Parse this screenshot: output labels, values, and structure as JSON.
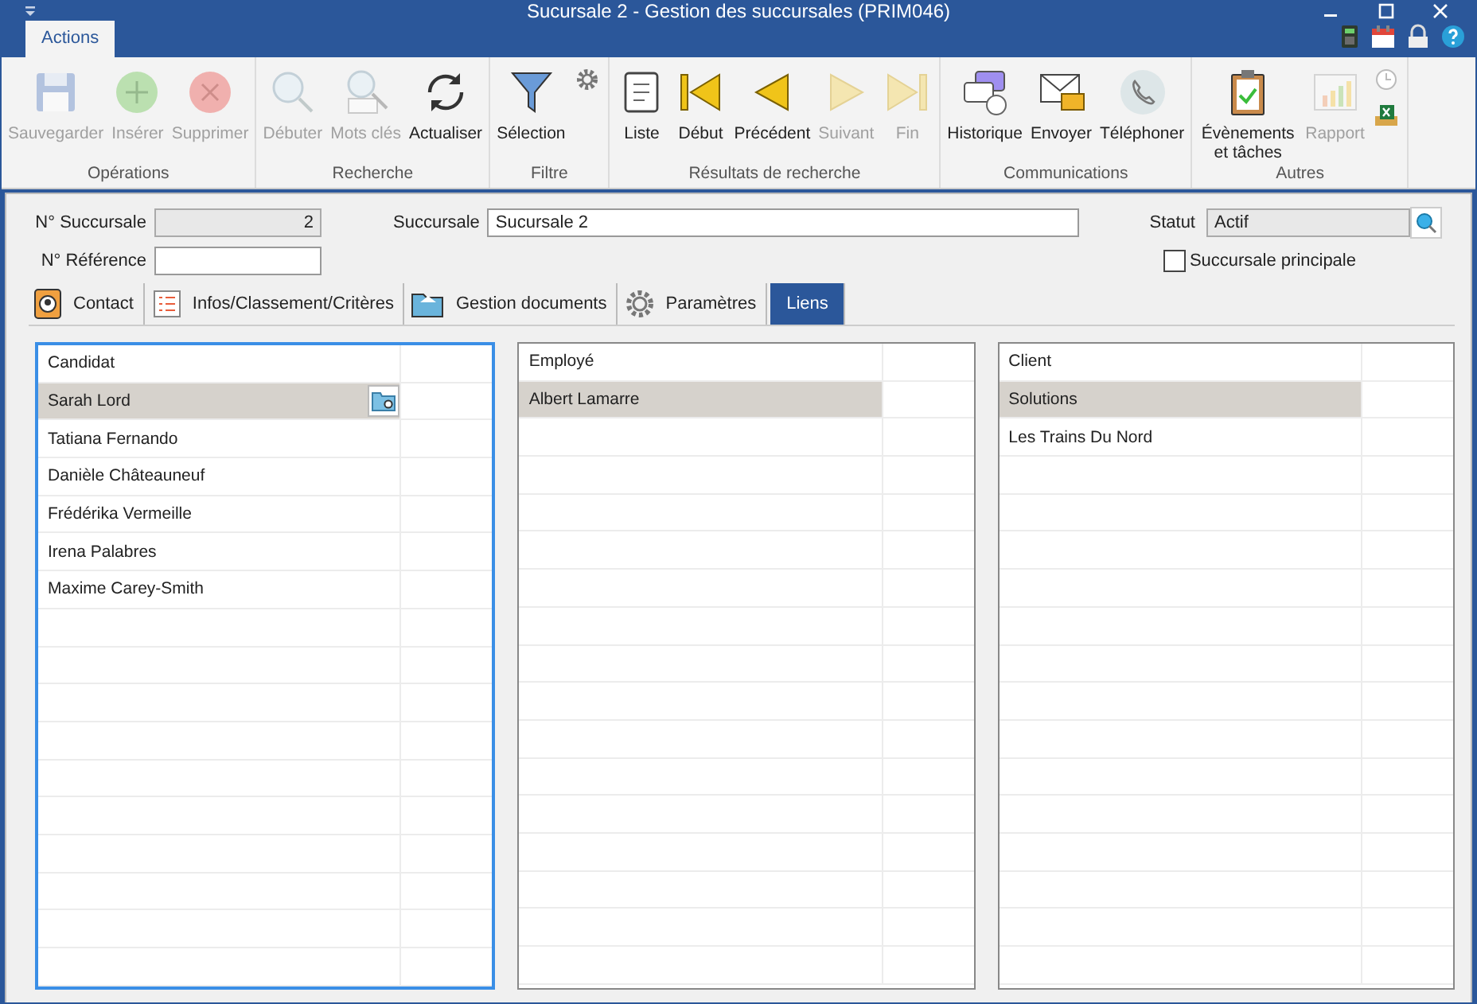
{
  "window": {
    "title": "Sucursale 2 - Gestion des succursales (PRIM046)"
  },
  "ribbon_tabs": [
    {
      "label": "Actions",
      "selected": true
    }
  ],
  "ribbon": {
    "groups": [
      {
        "label": "Opérations",
        "buttons": [
          {
            "kind": "save",
            "label": "Sauvegarder",
            "disabled": true
          },
          {
            "kind": "add",
            "label": "Insérer",
            "disabled": true
          },
          {
            "kind": "delete",
            "label": "Supprimer",
            "disabled": true
          }
        ]
      },
      {
        "label": "Recherche",
        "buttons": [
          {
            "kind": "search",
            "label": "Débuter",
            "disabled": true
          },
          {
            "kind": "keywords",
            "label": "Mots clés",
            "disabled": true
          },
          {
            "kind": "refresh",
            "label": "Actualiser",
            "disabled": false
          }
        ]
      },
      {
        "label": "Filtre",
        "buttons": [
          {
            "kind": "filter",
            "label": "Sélection",
            "disabled": false
          },
          {
            "kind": "gear",
            "disabled": false
          }
        ]
      },
      {
        "label": "Résultats de recherche",
        "buttons": [
          {
            "kind": "list",
            "label": "Liste",
            "disabled": false
          },
          {
            "kind": "first",
            "label": "Début",
            "disabled": false
          },
          {
            "kind": "previous",
            "label": "Précédent",
            "disabled": false
          },
          {
            "kind": "next",
            "label": "Suivant",
            "disabled": true
          },
          {
            "kind": "last",
            "label": "Fin",
            "disabled": true
          }
        ]
      },
      {
        "label": "Communications",
        "buttons": [
          {
            "kind": "history",
            "label": "Historique",
            "disabled": false
          },
          {
            "kind": "send",
            "label": "Envoyer",
            "disabled": false
          },
          {
            "kind": "phone",
            "label": "Téléphoner",
            "disabled": false
          }
        ]
      },
      {
        "label": "Autres",
        "buttons": [
          {
            "kind": "tasks",
            "label": "Évènements et tâches",
            "disabled": false
          },
          {
            "kind": "report",
            "label": "Rapport",
            "disabled": true
          },
          {
            "kind": "stack",
            "disabled": false
          }
        ]
      }
    ]
  },
  "form": {
    "branch_number": {
      "label": "N° Succursale",
      "value": "2"
    },
    "reference": {
      "label": "N° Référence"
    },
    "branch": {
      "label": "Succursale",
      "value": "Sucursale 2"
    },
    "status": {
      "label": "Statut",
      "value": "Actif"
    },
    "main_branch": {
      "label": "Succursale principale",
      "checked": false
    }
  },
  "tabs": [
    {
      "kind": "contact",
      "label": "Contact",
      "selected": false
    },
    {
      "kind": "list",
      "label": "Infos/Classement/Critères",
      "selected": false
    },
    {
      "kind": "folder",
      "label": "Gestion documents",
      "selected": false
    },
    {
      "kind": "gear",
      "label": "Paramètres",
      "selected": false
    },
    {
      "kind": "none",
      "label": "Liens",
      "selected": true
    }
  ],
  "lists": [
    {
      "column": "Candidat",
      "focused": true,
      "rows": [
        {
          "text": "Sarah Lord",
          "selected": true
        },
        {
          "text": "Tatiana Fernando",
          "selected": false
        },
        {
          "text": "Danièle Châteauneuf",
          "selected": false
        },
        {
          "text": "Frédérika Vermeille",
          "selected": false
        },
        {
          "text": "Irena Palabres",
          "selected": false
        },
        {
          "text": "Maxime Carey-Smith",
          "selected": false
        }
      ]
    },
    {
      "column": "Employé",
      "focused": false,
      "rows": [
        {
          "text": "Albert Lamarre",
          "selected": true
        }
      ]
    },
    {
      "column": "Client",
      "focused": false,
      "rows": [
        {
          "text": "Solutions",
          "selected": true
        },
        {
          "text": "Les Trains Du Nord",
          "selected": false
        }
      ]
    }
  ]
}
